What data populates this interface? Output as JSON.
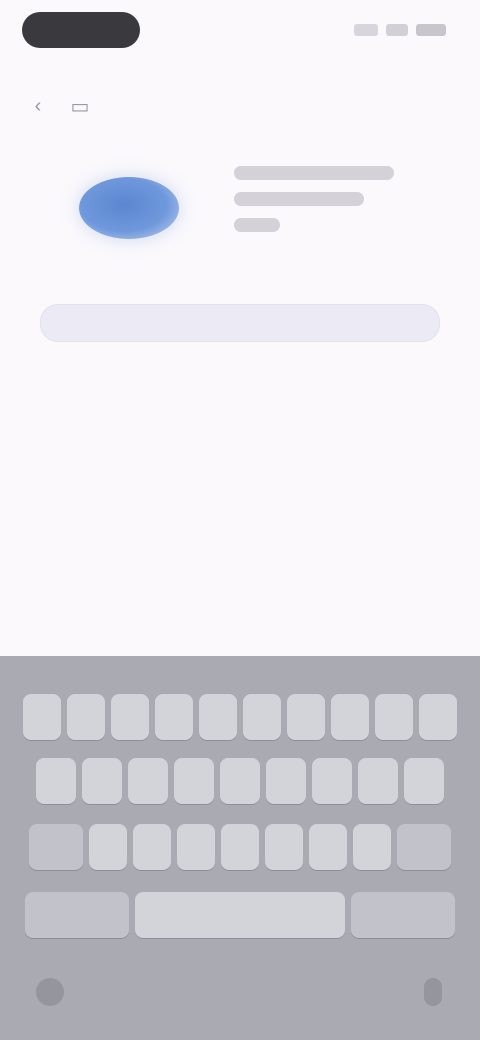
{
  "status": {
    "time": "",
    "indicators": [
      "signal-icon",
      "wifi-icon",
      "battery-icon"
    ]
  },
  "toolbar": {
    "icons": [
      "back-icon",
      "tab-icon"
    ]
  },
  "preview": {
    "icon": "blue-oval"
  },
  "url": {
    "value": ""
  },
  "keyboard": {
    "type": "ios-keyboard",
    "rows": [
      {
        "count": 10
      },
      {
        "count": 9
      },
      {
        "count": 9
      },
      {
        "count": 3
      }
    ],
    "bottom_icons": [
      "globe-icon",
      "mic-icon"
    ]
  },
  "colors": {
    "page_bg": "#fbf9fc",
    "keyboard_bg": "#a9aab2",
    "accent": "#5b87d0"
  }
}
